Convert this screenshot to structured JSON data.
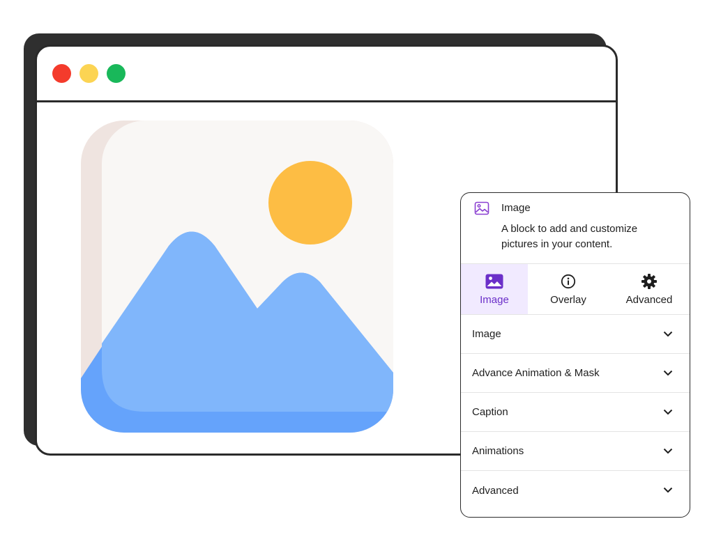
{
  "window": {
    "controls": [
      {
        "name": "close",
        "color": "#f43b2c"
      },
      {
        "name": "minimize",
        "color": "#fcd453"
      },
      {
        "name": "maximize",
        "color": "#19b85a"
      }
    ]
  },
  "illustration": {
    "icon": "image-placeholder-icon",
    "colors": {
      "frame": "#f9f7f5",
      "frame_edge": "#efe4e0",
      "sun": "#fecb6b",
      "sun_shade": "#fdbd44",
      "mountain": "#80b6fb",
      "mountain_dark": "#65a3fb"
    }
  },
  "panel": {
    "block_icon": "image-icon",
    "title": "Image",
    "description": "A block to add and customize pictures in your content.",
    "accent": "#6b2fc9",
    "tabs": [
      {
        "label": "Image",
        "icon": "image-icon",
        "active": true
      },
      {
        "label": "Overlay",
        "icon": "info-circle-icon",
        "active": false
      },
      {
        "label": "Advanced",
        "icon": "gear-icon",
        "active": false
      }
    ],
    "sections": [
      {
        "label": "Image"
      },
      {
        "label": "Advance Animation & Mask"
      },
      {
        "label": "Caption"
      },
      {
        "label": "Animations"
      },
      {
        "label": "Advanced"
      }
    ]
  }
}
